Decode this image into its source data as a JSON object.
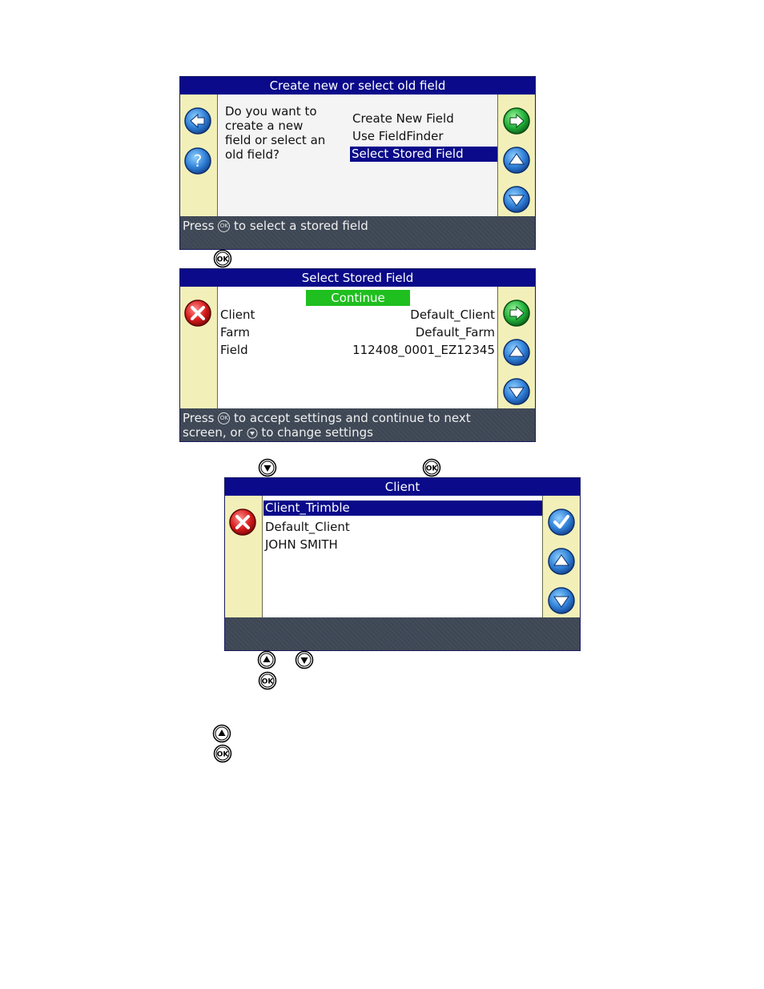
{
  "screen1": {
    "title": "Create new or select old field",
    "question": [
      "Do you want to",
      "create a new",
      "field or select an",
      "old field?"
    ],
    "options": [
      "Create New Field",
      "Use FieldFinder",
      "Select Stored Field"
    ],
    "selected_index": 2,
    "status": {
      "prefix": "Press",
      "ok": "OK",
      "suffix": "to select a stored field"
    }
  },
  "between1": {
    "ok": "OK"
  },
  "screen2": {
    "title": "Select Stored Field",
    "continue_label": "Continue",
    "rows": [
      {
        "label": "Client",
        "value": "Default_Client"
      },
      {
        "label": "Farm",
        "value": "Default_Farm"
      },
      {
        "label": "Field",
        "value": "112408_0001_EZ12345"
      }
    ],
    "status": {
      "line1_prefix": "Press",
      "ok": "OK",
      "line1_suffix": "to accept settings and continue to next",
      "line2_prefix": "screen, or",
      "line2_suffix": "to change settings"
    }
  },
  "between2": {
    "ok": "OK"
  },
  "screen3": {
    "title": "Client",
    "items": [
      "Client_Trimble",
      "Default_Client",
      "JOHN SMITH"
    ],
    "selected_index": 0
  },
  "between3": {
    "ok": "OK"
  },
  "between4": {
    "ok": "OK"
  },
  "colors": {
    "title_bar": "#0a0a8a",
    "side_panel": "#f2f0b8",
    "status_bar": "#3d4654",
    "continue": "#1fbf1f",
    "blue_button": "#2f7fd6",
    "green_button": "#21b13a",
    "red_button": "#d61a1a"
  },
  "icons": [
    "back-arrow-icon",
    "help-icon",
    "next-arrow-icon",
    "up-arrow-icon",
    "down-arrow-icon",
    "cancel-x-icon",
    "checkmark-icon",
    "ok-key-icon",
    "up-key-icon",
    "down-key-icon"
  ]
}
